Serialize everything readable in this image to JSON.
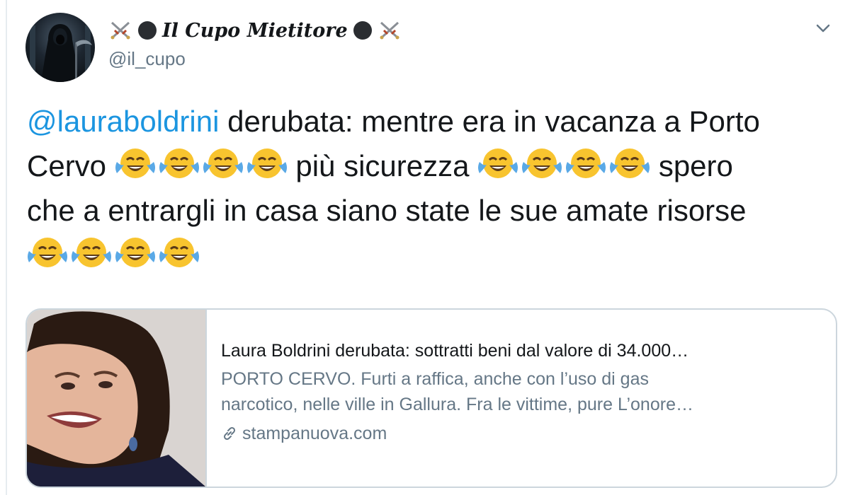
{
  "author": {
    "display_name": "Il Cupo Mietitore",
    "handle": "@il_cupo",
    "avatar_icon": "hooded-reaper-avatar",
    "name_decor_icons": [
      "crossed-swords-icon",
      "black-circle-icon",
      "black-circle-icon",
      "crossed-swords-icon"
    ]
  },
  "tweet": {
    "mention": "@lauraboldrini",
    "line1_rest": " derubata: mentre era in vacanza a Porto",
    "line2_a": "Cervo ",
    "line2_b": " più sicurezza ",
    "line2_c": " spero",
    "line3": "che a entrargli in casa siano state le sue amate risorse",
    "emoji_icon": "face-with-tears-of-joy-icon",
    "mention_color": "#1b95e0"
  },
  "card": {
    "title": "Laura Boldrini derubata: sottratti beni dal valore di 34.000…",
    "description_line1": "PORTO CERVO. Furti a raffica, anche con l’uso di gas",
    "description_line2": "narcotico, nelle ville in Gallura. Fra le vittime, pure L’onore…",
    "domain": "stampanuova.com",
    "link_icon": "link-icon",
    "image_icon": "article-photo"
  },
  "menu": {
    "caret_icon": "chevron-down-icon"
  }
}
